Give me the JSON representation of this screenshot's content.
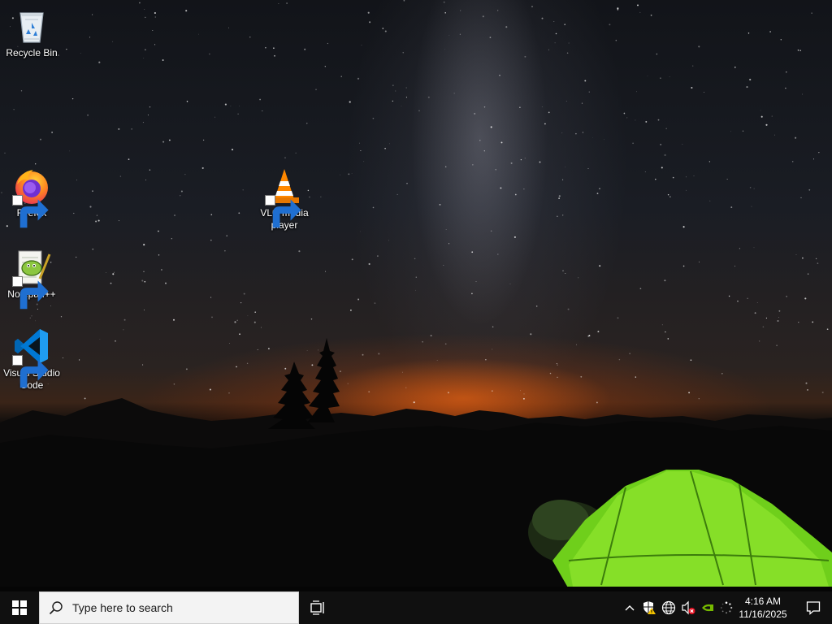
{
  "desktop": {
    "icons": [
      {
        "name": "recycle-bin",
        "label": "Recycle Bin",
        "icon": "recycle-bin-icon"
      },
      {
        "name": "firefox",
        "label": "Firefox",
        "icon": "firefox-icon",
        "shortcut": true
      },
      {
        "name": "vlc",
        "label": "VLC media player",
        "icon": "vlc-icon",
        "shortcut": true
      },
      {
        "name": "notepadpp",
        "label": "Notepad++",
        "icon": "notepadpp-icon",
        "shortcut": true
      },
      {
        "name": "vscode",
        "label": "Visual Studio Code",
        "icon": "vscode-icon",
        "shortcut": true
      }
    ],
    "wallpaper": "night sky with milky way, mountains and green tent"
  },
  "taskbar": {
    "start_icon": "windows-logo-icon",
    "search": {
      "placeholder": "Type here to search",
      "icon": "search-icon"
    },
    "task_view_icon": "task-view-icon",
    "tray": {
      "chevron_icon": "chevron-up-icon",
      "icons": [
        "security-warning-icon",
        "network-icon",
        "volume-muted-icon",
        "nvidia-icon",
        "loading-icon"
      ]
    },
    "clock": {
      "time": "4:16 AM",
      "date": "11/16/2025"
    },
    "notification_icon": "action-center-icon"
  },
  "colors": {
    "taskbar_bg": "#101010",
    "search_bg": "#f3f3f3",
    "accent_tent": "#7ed321",
    "sky_glow": "#ff6a14"
  }
}
